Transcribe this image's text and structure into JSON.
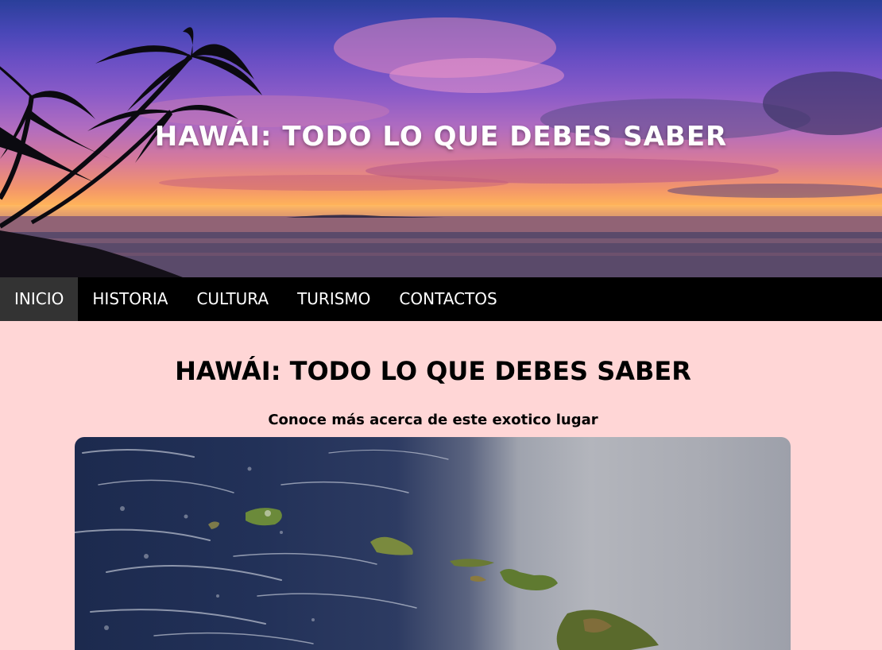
{
  "header": {
    "title": "HAWÁI: TODO LO QUE DEBES SABER"
  },
  "nav": {
    "items": [
      {
        "label": "INICIO",
        "active": true
      },
      {
        "label": "HISTORIA",
        "active": false
      },
      {
        "label": "CULTURA",
        "active": false
      },
      {
        "label": "TURISMO",
        "active": false
      },
      {
        "label": "CONTACTOS",
        "active": false
      }
    ]
  },
  "main": {
    "title": "HAWÁI: TODO LO QUE DEBES SABER",
    "subtitle": "Conoce más acerca de este exotico lugar"
  },
  "colors": {
    "page_background": "#ffd6d6",
    "nav_background": "#000000",
    "nav_active": "#333333",
    "nav_text": "#ffffff"
  }
}
